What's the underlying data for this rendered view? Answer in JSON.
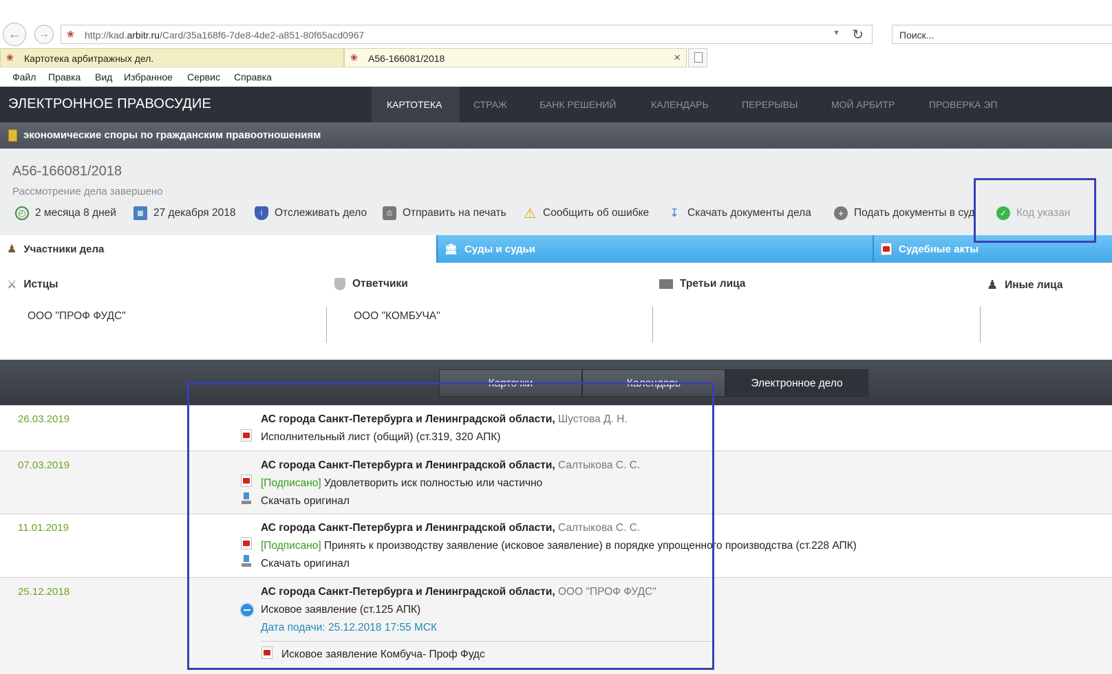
{
  "browser": {
    "url_prefix": "http://kad.",
    "url_domain": "arbitr.ru",
    "url_rest": "/Card/35a168f6-7de8-4de2-a851-80f65acd0967",
    "search_placeholder": "Поиск...",
    "tabs": [
      {
        "label": "Картотека арбитражных дел."
      },
      {
        "label": "А56-166081/2018"
      }
    ],
    "menu": [
      "Файл",
      "Правка",
      "Вид",
      "Избранное",
      "Сервис",
      "Справка"
    ]
  },
  "header": {
    "title": "ЭЛЕКТРОННОЕ ПРАВОСУДИЕ",
    "nav": [
      "КАРТОТЕКА",
      "СТРАЖ",
      "БАНК РЕШЕНИЙ",
      "КАЛЕНДАРЬ",
      "ПЕРЕРЫВЫ",
      "МОЙ АРБИТР",
      "ПРОВЕРКА ЭП"
    ]
  },
  "category": "экономические споры по гражданским правоотношениям",
  "case": {
    "number": "А56-166081/2018",
    "status": "Рассмотрение дела завершено",
    "tools": {
      "duration": "2 месяца 8 дней",
      "date": "27 декабря 2018",
      "track": "Отслеживать дело",
      "print": "Отправить на печать",
      "report": "Сообщить об ошибке",
      "download": "Скачать документы дела",
      "submit": "Подать документы в суд",
      "code": "Код указан"
    }
  },
  "section_tabs": {
    "participants": "Участники дела",
    "courts": "Суды и судьи",
    "acts": "Судебные акты"
  },
  "participants": {
    "plaintiffs_title": "Истцы",
    "plaintiff": "ООО \"ПРОФ ФУДС\"",
    "defendants_title": "Ответчики",
    "defendant": "ООО \"КОМБУЧА\"",
    "third_title": "Третьи лица",
    "other_title": "Иные лица"
  },
  "views": [
    "Карточки",
    "Календарь",
    "Электронное дело"
  ],
  "documents": [
    {
      "date": "26.03.2019",
      "court": "АС города Санкт-Петербурга и Ленинградской области,",
      "judge": "Шустова Д. Н.",
      "title": "Исполнительный лист (общий) (ст.319, 320 АПК)"
    },
    {
      "date": "07.03.2019",
      "court": "АС города Санкт-Петербурга и Ленинградской области,",
      "judge": "Салтыкова С. С.",
      "signed": "[Подписано]",
      "title": "Удовлетворить иск полностью или частично",
      "download": "Скачать оригинал"
    },
    {
      "date": "11.01.2019",
      "court": "АС города Санкт-Петербурга и Ленинградской области,",
      "judge": "Салтыкова С. С.",
      "signed": "[Подписано]",
      "title": "Принять к производству заявление (исковое заявление) в порядке упрощенного производства (ст.228 АПК)",
      "download": "Скачать оригинал"
    },
    {
      "date": "25.12.2018",
      "court": "АС города Санкт-Петербурга и Ленинградской области,",
      "judge": "ООО \"ПРОФ ФУДС\"",
      "title": "Исковое заявление (ст.125 АПК)",
      "filed": "Дата подачи: 25.12.2018 17:55 МСК",
      "attachment": "Исковое заявление Комбуча- Проф Фудс"
    }
  ],
  "colors": {
    "header_bg": "#2c3038",
    "tab_blue": "#42a9ea",
    "date_green": "#6aa522",
    "signed_green": "#2f9d1c",
    "filed_blue": "#1d8bb8",
    "highlight": "#3a3fb5"
  }
}
